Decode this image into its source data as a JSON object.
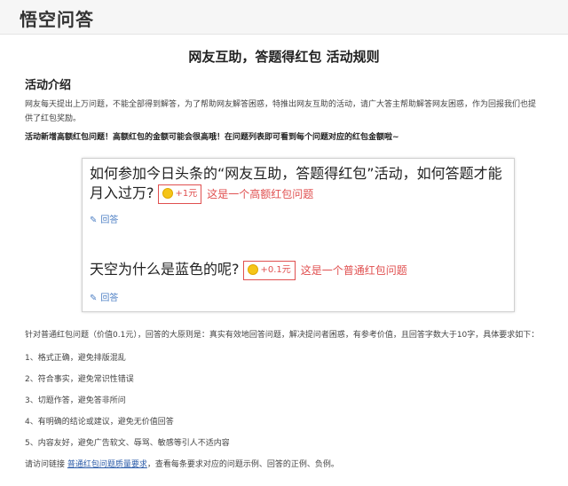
{
  "header": {
    "logo": "悟空问答"
  },
  "page": {
    "title": "网友互助，答题得红包 活动规则",
    "section_title": "活动介绍",
    "intro": "网友每天提出上万问题，不能全部得到解答，为了帮助网友解答困惑，特推出网友互助的活动，请广大答主帮助解答网友困惑，作为回报我们也提供了红包奖励。",
    "highlight": "活动新增高额红包问题！高额红包的金额可能会很高哦！在问题列表即可看到每个问题对应的红包金额啦~"
  },
  "example": {
    "q1": "如何参加今日头条的“网友互助，答题得红包”活动，如何答题才能月入过万?",
    "q1_reward": "+1元",
    "q1_note": "这是一个高额红包问题",
    "q2": "天空为什么是蓝色的呢?",
    "q2_reward": "+0.1元",
    "q2_note": "这是一个普通红包问题",
    "answer_label": "回答"
  },
  "rules": {
    "lead": "针对普通红包问题（价值0.1元），回答的大原则是：真实有效地回答问题，解决提问者困惑，有参考价值，且回答字数大于10字，具体要求如下：",
    "items": [
      "1、格式正确，避免排版混乱",
      "2、符合事实，避免常识性错误",
      "3、切题作答，避免答非所问",
      "4、有明确的结论或建议，避免无价值回答",
      "5、内容友好，避免广告软文、辱骂、敏感等引人不适内容"
    ],
    "footer_prefix": "请访问链接 ",
    "footer_link": "普通红包问题质量要求",
    "footer_suffix": "，查看每条要求对应的问题示例、回答的正例、负例。"
  }
}
